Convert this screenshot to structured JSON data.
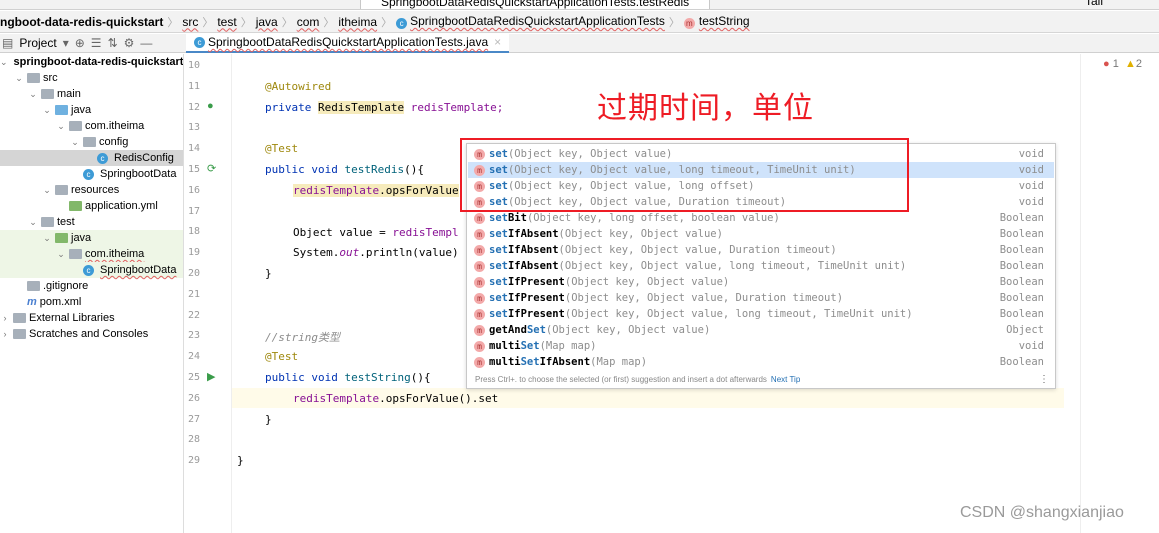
{
  "toolbar": {
    "run_config": "SpringbootDataRedisQuickstartApplicationTests.testRedis",
    "tail": "Tail"
  },
  "breadcrumb": [
    "ngboot-data-redis-quickstart",
    "src",
    "test",
    "java",
    "com",
    "itheima",
    "SpringbootDataRedisQuickstartApplicationTests",
    "testString"
  ],
  "tabs": {
    "project_label": "Project",
    "file_tab": "SpringbootDataRedisQuickstartApplicationTests.java"
  },
  "tree": [
    {
      "label": "springboot-data-redis-quickstart",
      "depth": 0,
      "icon": "module-folder",
      "bold": true
    },
    {
      "label": "src",
      "depth": 1,
      "icon": "folder"
    },
    {
      "label": "main",
      "depth": 2,
      "icon": "folder"
    },
    {
      "label": "java",
      "depth": 3,
      "icon": "source-folder"
    },
    {
      "label": "com.itheima",
      "depth": 4,
      "icon": "package"
    },
    {
      "label": "config",
      "depth": 5,
      "icon": "package"
    },
    {
      "label": "RedisConfig",
      "depth": 6,
      "icon": "class",
      "selected": true
    },
    {
      "label": "SpringbootData",
      "depth": 5,
      "icon": "spring-class"
    },
    {
      "label": "resources",
      "depth": 3,
      "icon": "resources-folder"
    },
    {
      "label": "application.yml",
      "depth": 4,
      "icon": "yaml-file"
    },
    {
      "label": "test",
      "depth": 2,
      "icon": "folder"
    },
    {
      "label": "java",
      "depth": 3,
      "icon": "test-folder",
      "green": true
    },
    {
      "label": "com.itheima",
      "depth": 4,
      "icon": "package",
      "green": true
    },
    {
      "label": "SpringbootData",
      "depth": 5,
      "icon": "test-class",
      "green": true
    },
    {
      "label": ".gitignore",
      "depth": 1,
      "icon": "gitignore-file"
    },
    {
      "label": "pom.xml",
      "depth": 1,
      "icon": "maven-file"
    },
    {
      "label": "External Libraries",
      "depth": 0,
      "icon": "libraries"
    },
    {
      "label": "Scratches and Consoles",
      "depth": 0,
      "icon": "scratches"
    }
  ],
  "line_numbers": [
    "10",
    "11",
    "12",
    "13",
    "14",
    "15",
    "16",
    "17",
    "18",
    "19",
    "20",
    "21",
    "22",
    "23",
    "24",
    "25",
    "26",
    "27",
    "28",
    "29"
  ],
  "code": {
    "l11": "@Autowired",
    "l12a": "private ",
    "l12b": "RedisTemplate",
    "l12c": " redisTemplate;",
    "l14": "@Test",
    "l15a": "public void ",
    "l15b": "testRedis",
    "l15c": "(){",
    "l16a": "redisTemplate",
    "l16b": ".opsForValue",
    "l18a": "Object value = ",
    "l18b": "redisTempl",
    "l19a": "System.",
    "l19b": "out",
    "l19c": ".println(value)",
    "l20": "}",
    "l23": "//string类型",
    "l24": "@Test",
    "l25a": "public void ",
    "l25b": "testString",
    "l25c": "(){",
    "l26a": "redisTemplate",
    "l26b": ".opsForValue().set",
    "l27": "}",
    "l29": "}"
  },
  "completion": {
    "items": [
      {
        "pre": "",
        "match": "set",
        "post": "",
        "params": "(Object key, Object value)",
        "type": "void"
      },
      {
        "pre": "",
        "match": "set",
        "post": "",
        "params": "(Object key, Object value, long timeout, TimeUnit unit)",
        "type": "void",
        "selected": true
      },
      {
        "pre": "",
        "match": "set",
        "post": "",
        "params": "(Object key, Object value, long offset)",
        "type": "void"
      },
      {
        "pre": "",
        "match": "set",
        "post": "",
        "params": "(Object key, Object value, Duration timeout)",
        "type": "void"
      },
      {
        "pre": "",
        "match": "set",
        "post": "Bit",
        "params": "(Object key, long offset, boolean value)",
        "type": "Boolean"
      },
      {
        "pre": "",
        "match": "set",
        "post": "IfAbsent",
        "params": "(Object key, Object value)",
        "type": "Boolean"
      },
      {
        "pre": "",
        "match": "set",
        "post": "IfAbsent",
        "params": "(Object key, Object value, Duration timeout)",
        "type": "Boolean"
      },
      {
        "pre": "",
        "match": "set",
        "post": "IfAbsent",
        "params": "(Object key, Object value, long timeout, TimeUnit unit)",
        "type": "Boolean"
      },
      {
        "pre": "",
        "match": "set",
        "post": "IfPresent",
        "params": "(Object key, Object value)",
        "type": "Boolean"
      },
      {
        "pre": "",
        "match": "set",
        "post": "IfPresent",
        "params": "(Object key, Object value, Duration timeout)",
        "type": "Boolean"
      },
      {
        "pre": "",
        "match": "set",
        "post": "IfPresent",
        "params": "(Object key, Object value, long timeout, TimeUnit unit)",
        "type": "Boolean"
      },
      {
        "pre": "getAnd",
        "match": "Set",
        "post": "",
        "params": "(Object key, Object value)",
        "type": "Object"
      },
      {
        "pre": "multi",
        "match": "Set",
        "post": "",
        "params": "(Map map)",
        "type": "void"
      },
      {
        "pre": "multi",
        "match": "Set",
        "post": "IfAbsent",
        "params": "(Map map)",
        "type": "Boolean"
      }
    ],
    "tip": "Press Ctrl+. to choose the selected (or first) suggestion and insert a dot afterwards",
    "next_tip": "Next Tip"
  },
  "annotation": {
    "note": "过期时间，单位",
    "color": "#ee1c25"
  },
  "inspections": {
    "errors": "1",
    "warnings": "2"
  },
  "watermark": "CSDN @shangxianjiao"
}
